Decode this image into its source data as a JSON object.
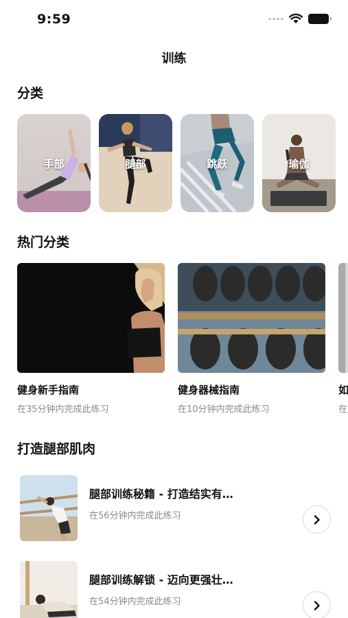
{
  "status_bar": {
    "time": "9:59",
    "icons": [
      "signal-icon",
      "wifi-icon",
      "battery-icon"
    ]
  },
  "nav": {
    "title": "训练"
  },
  "categories_section": {
    "title": "分类",
    "items": [
      {
        "label": "手部",
        "icon": "arm-workout-photo"
      },
      {
        "label": "腿部",
        "icon": "leg-workout-photo"
      },
      {
        "label": "跳跃",
        "icon": "jump-workout-photo"
      },
      {
        "label": "瑜伽",
        "icon": "yoga-photo"
      }
    ]
  },
  "popular_section": {
    "title": "热门分类",
    "items": [
      {
        "title": "健身新手指南",
        "subtitle": "在35分钟内完成此练习"
      },
      {
        "title": "健身器械指南",
        "subtitle": "在10分钟内完成此练习"
      },
      {
        "title": "如",
        "subtitle": "在"
      }
    ]
  },
  "legs_section": {
    "title": "打造腿部肌肉",
    "items": [
      {
        "title": "腿部训练秘籍 - 打造结实有…",
        "subtitle": "在56分钟内完成此练习"
      },
      {
        "title": "腿部训练解锁 - 迈向更强壮…",
        "subtitle": "在54分钟内完成此练习"
      }
    ]
  },
  "colors": {
    "text": "#111111",
    "secondary_text": "#8a8a8a",
    "background": "#ffffff"
  }
}
